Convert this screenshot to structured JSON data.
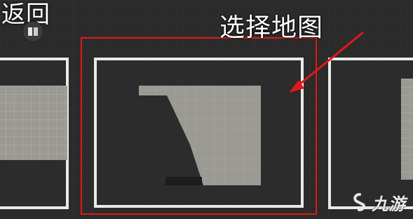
{
  "nav": {
    "back_label": "返回",
    "back_icon": "book-icon"
  },
  "annotation": {
    "title": "选择地图",
    "highlight_color": "#e01818"
  },
  "maps": {
    "items": [
      {
        "id": "left",
        "selected": false
      },
      {
        "id": "middle",
        "selected": true
      },
      {
        "id": "right",
        "selected": false
      }
    ]
  },
  "watermark": {
    "text": "九游",
    "logo_icon": "jiuyou-logo-icon"
  },
  "colors": {
    "background": "#2b2b2b",
    "card_border": "#e9e9e9",
    "map_fill": "#9a9a92"
  }
}
